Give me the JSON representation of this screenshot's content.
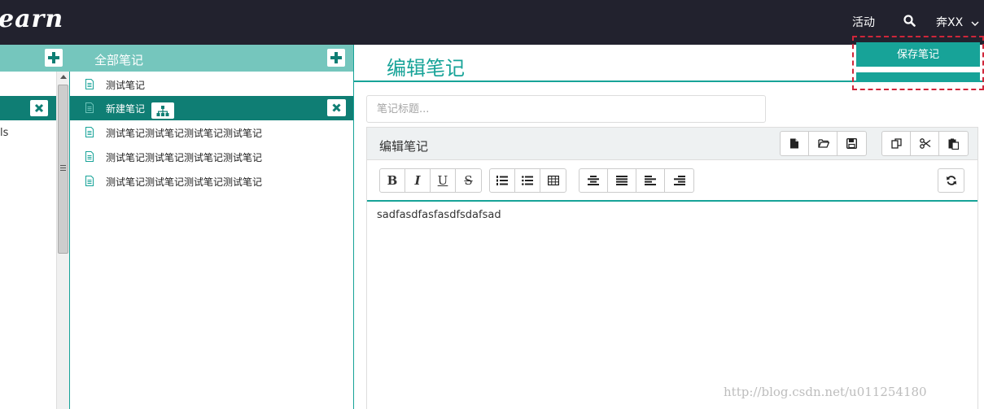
{
  "app": {
    "logo": "earn"
  },
  "topnav": {
    "activity": "活动",
    "user": "奔XX"
  },
  "notes_panel": {
    "header": "全部笔记",
    "items": [
      {
        "label": "测试笔记"
      },
      {
        "label": "新建笔记"
      },
      {
        "label": "测试笔记测试笔记测试笔记测试笔记"
      },
      {
        "label": "测试笔记测试笔记测试笔记测试笔记"
      },
      {
        "label": "测试笔记测试笔记测试笔记测试笔记"
      }
    ]
  },
  "notebooks_panel": {
    "partial_item": "ls"
  },
  "editor": {
    "page_title": "编辑笔记",
    "save_label": "保存笔记",
    "title_placeholder": "笔记标题...",
    "panel_title": "编辑笔记",
    "content": "sadfasdfasfasdfsdafsad"
  },
  "watermark": "http://blog.csdn.net/u011254180"
}
